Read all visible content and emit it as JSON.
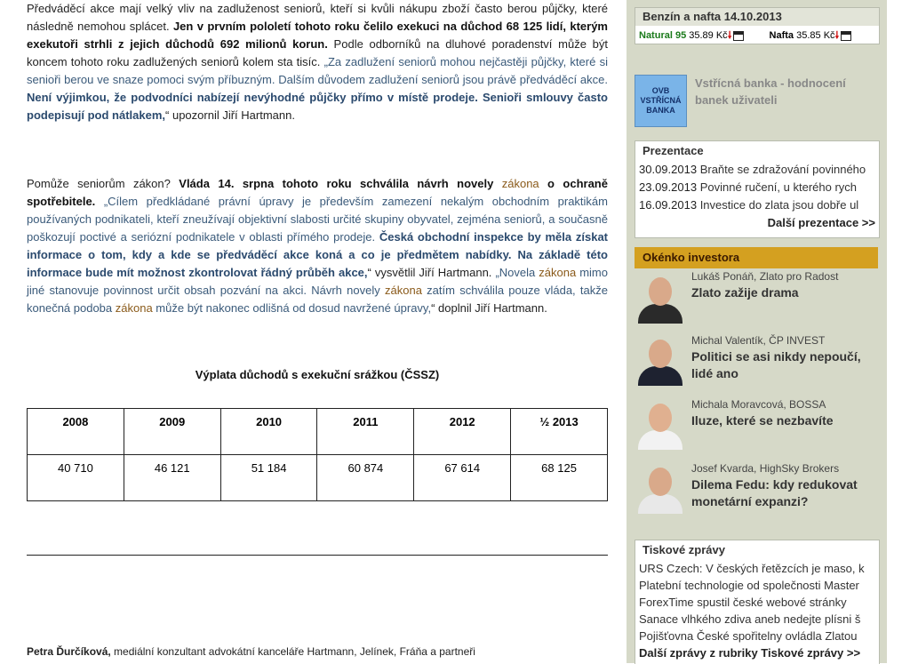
{
  "article": {
    "p1": {
      "a": "Předváděcí akce mají velký vliv na zadluženost seniorů, kteří si kvůli nákupu zboží často berou půjčky, které následně nemohou splácet.",
      "b": " Jen v prvním pololetí tohoto roku čelilo exekuci na důchod 68 125 lidí, kterým exekutoři strhli z jejich důchodů 692 milionů korun.",
      "c": " Podle odborníků na dluhové poradenství může být koncem tohoto roku zadlužených seniorů kolem sta tisíc.",
      "d": " „Za zadlužení seniorů mohou nejčastěji půjčky, které si senioři berou ve snaze pomoci svým příbuzným. Dalším důvodem zadlužení seniorů jsou právě předváděcí akce.",
      "e": " Není výjimkou, že podvodníci nabízejí nevýhodné půjčky přímo v místě prodeje. Senioři smlouvy často podepisují pod nátlakem,",
      "f": "“ upozornil Jiří Hartmann."
    },
    "p2": {
      "a": "Pomůže seniorům zákon?",
      "b1": " Vláda 14. srpna tohoto roku schválila návrh novely ",
      "kw1": "zákona",
      "b2": " o ochraně spotřebitele.",
      "c": " „Cílem předkládané právní úpravy je především zamezení nekalým obchodním praktikám používaných podnikateli, kteří zneužívají objektivní slabosti určité skupiny obyvatel, zejména seniorů, a současně poškozují poctivé a seriózní podnikatele v oblasti přímého prodeje.",
      "d": " Česká obchodní inspekce by měla získat informace o tom, kdy a kde se předváděcí akce koná a co je předmětem nabídky. Na základě této informace bude mít možnost zkontrolovat řádný průběh akce,",
      "e": "“ vysvětlil Jiří Hartmann.",
      "f1": " „Novela ",
      "kw2": "zákona",
      "f2": " mimo jiné stanovuje povinnost určit obsah pozvání na akci. Návrh novely ",
      "kw3": "zákona",
      "f3": " zatím schválila pouze vláda, takže konečná podoba ",
      "kw4": "zákona",
      "f4": " může být nakonec odlišná od dosud navržené úpravy,",
      "g": "“ doplnil Jiří Hartmann."
    },
    "table_title": "Výplata důchodů s exekuční srážkou (ČSSZ)",
    "table": {
      "headers": [
        "2008",
        "2009",
        "2010",
        "2011",
        "2012",
        "½ 2013"
      ],
      "values": [
        "40 710",
        "46 121",
        "51 184",
        "60 874",
        "67 614",
        "68 125"
      ]
    },
    "author_name": "Petra Ďurčíková,",
    "author_role": " mediální konzultant advokátní kanceláře Hartmann, Jelínek, Fráňa a partneři"
  },
  "sidebar": {
    "fuel": {
      "title": "Benzín a nafta 14.10.2013",
      "natural_label": "Natural 95",
      "natural_price": "35.89 Kč",
      "nafta_label": "Nafta",
      "nafta_price": "35.85 Kč",
      "arrow": "🠗",
      "trend_color": "#d01010"
    },
    "bank": {
      "logo": "OVB VSTŘÍCNÁ BANKA",
      "logo_l1": "OVB",
      "logo_l2": "VSTŘÍCNÁ",
      "logo_l3": "BANKA",
      "text": "Vstřícná banka - hodnocení banek uživateli"
    },
    "prezentace": {
      "title": "Prezentace",
      "items": [
        {
          "date": "30.09.2013",
          "text": " Braňte se zdražování povinného"
        },
        {
          "date": "23.09.2013",
          "text": " Povinné ručení, u kterého rych"
        },
        {
          "date": "16.09.2013",
          "text": " Investice do zlata jsou dobře ul"
        }
      ],
      "more": "Další prezentace >>"
    },
    "okenko": {
      "title": "Okénko investora",
      "accent": "#d4a020",
      "items": [
        {
          "name": "Lukáš Ponáň, Zlato pro Radost",
          "headline": "Zlato zažije drama"
        },
        {
          "name": "Michal Valentík, ČP INVEST",
          "headline": "Politici se asi nikdy nepoučí, lidé ano"
        },
        {
          "name": "Michala Moravcová, BOSSA",
          "headline": "Iluze, které se nezbavíte"
        },
        {
          "name": "Josef Kvarda, HighSky Brokers",
          "headline": "Dilema Fedu: kdy redukovat monetární expanzi?"
        }
      ]
    },
    "tiskove": {
      "title": "Tiskové zprávy",
      "items": [
        "URS Czech: V českých řetězcích je maso, k",
        "Platební technologie od společnosti Master",
        "ForexTime spustil české webové stránky",
        "Sanace vlhkého zdiva aneb nedejte plísni š",
        "Pojišťovna České spořitelny ovládla Zlatou"
      ],
      "more": "Další zprávy z rubriky Tiskové zprávy >>"
    }
  }
}
